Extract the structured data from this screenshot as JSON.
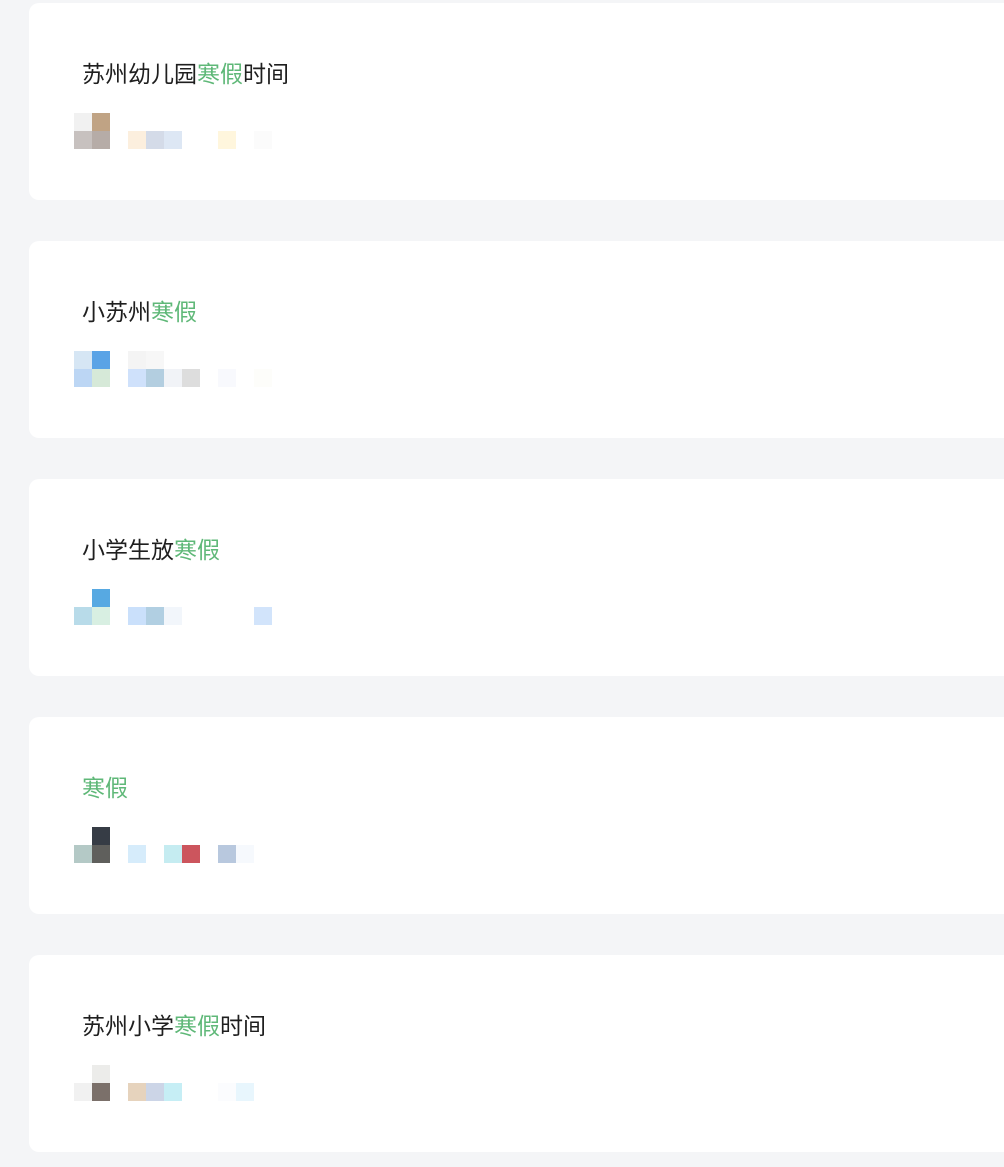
{
  "colors": {
    "page_background": "#f4f5f7",
    "card_background": "#ffffff",
    "title_text": "#1f1f1f",
    "keyword_highlight": "#5fb878"
  },
  "results": [
    {
      "title_parts": [
        {
          "text": "苏州幼儿园",
          "highlight": false
        },
        {
          "text": "寒假",
          "highlight": true
        },
        {
          "text": "时间",
          "highlight": false
        }
      ],
      "thumb_icon": "blurred-thumbnail-icon",
      "thumb_colors": [
        [
          "#f1f1f1",
          "#c0a384",
          null,
          null,
          null,
          null,
          null,
          null,
          null,
          null,
          null
        ],
        [
          "#c7c1bf",
          "#b6aca7",
          null,
          "#fcefde",
          "#d4dbe8",
          "#dde7f4",
          null,
          null,
          "#fff6dd",
          null,
          "#fbfbfb"
        ]
      ]
    },
    {
      "title_parts": [
        {
          "text": "小苏州",
          "highlight": false
        },
        {
          "text": "寒假",
          "highlight": true
        }
      ],
      "thumb_icon": "blurred-thumbnail-icon",
      "thumb_colors": [
        [
          "#d6e6f4",
          "#5aa3e6",
          null,
          "#f4f4f4",
          "#f7f7f7",
          null,
          null,
          null,
          null,
          null,
          null
        ],
        [
          "#bcd6f4",
          "#d6e9d8",
          null,
          "#cfe1fb",
          "#b3cee0",
          "#f1f3f7",
          "#dddddd",
          null,
          "#f8f9fd",
          null,
          "#fdfdfa"
        ]
      ]
    },
    {
      "title_parts": [
        {
          "text": "小学生放",
          "highlight": false
        },
        {
          "text": "寒假",
          "highlight": true
        }
      ],
      "thumb_icon": "blurred-thumbnail-icon",
      "thumb_colors": [
        [
          null,
          "#57a9e2",
          null,
          null,
          null,
          null,
          null,
          null,
          null,
          null,
          null
        ],
        [
          "#b8dbe9",
          "#d8efe2",
          null,
          "#cae0fb",
          "#b1cfe2",
          "#f2f6fb",
          null,
          null,
          null,
          null,
          "#d2e4fb"
        ]
      ]
    },
    {
      "title_parts": [
        {
          "text": "寒假",
          "highlight": true
        }
      ],
      "thumb_icon": "blurred-thumbnail-icon",
      "thumb_colors": [
        [
          null,
          "#363c45",
          null,
          null,
          null,
          null,
          null,
          null,
          null,
          null,
          null
        ],
        [
          "#b4c9c6",
          "#5f5f5c",
          null,
          "#d6ecfb",
          null,
          "#c5ecf1",
          "#cc555d",
          null,
          "#b8c8de",
          "#f6f9fd",
          null
        ]
      ]
    },
    {
      "title_parts": [
        {
          "text": "苏州小学",
          "highlight": false
        },
        {
          "text": "寒假",
          "highlight": true
        },
        {
          "text": "时间",
          "highlight": false
        }
      ],
      "thumb_icon": "blurred-thumbnail-icon",
      "thumb_colors": [
        [
          null,
          "#ececea",
          null,
          null,
          null,
          null,
          null,
          null,
          null,
          null,
          null
        ],
        [
          "#f1f1f1",
          "#7b706a",
          null,
          "#e6d3bd",
          "#ccd5e7",
          "#c6eef5",
          null,
          null,
          "#fbfcfe",
          "#e8f6fd",
          null
        ]
      ]
    }
  ]
}
